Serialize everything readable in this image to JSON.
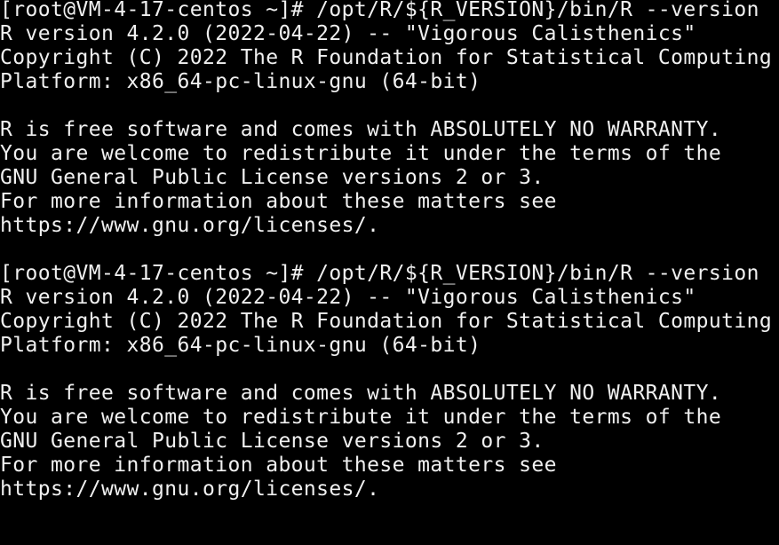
{
  "terminal": {
    "lines": [
      "[root@VM-4-17-centos ~]# /opt/R/${R_VERSION}/bin/R --version",
      "R version 4.2.0 (2022-04-22) -- \"Vigorous Calisthenics\"",
      "Copyright (C) 2022 The R Foundation for Statistical Computing",
      "Platform: x86_64-pc-linux-gnu (64-bit)",
      "",
      "R is free software and comes with ABSOLUTELY NO WARRANTY.",
      "You are welcome to redistribute it under the terms of the",
      "GNU General Public License versions 2 or 3.",
      "For more information about these matters see",
      "https://www.gnu.org/licenses/.",
      "",
      "[root@VM-4-17-centos ~]# /opt/R/${R_VERSION}/bin/R --version",
      "R version 4.2.0 (2022-04-22) -- \"Vigorous Calisthenics\"",
      "Copyright (C) 2022 The R Foundation for Statistical Computing",
      "Platform: x86_64-pc-linux-gnu (64-bit)",
      "",
      "R is free software and comes with ABSOLUTELY NO WARRANTY.",
      "You are welcome to redistribute it under the terms of the",
      "GNU General Public License versions 2 or 3.",
      "For more information about these matters see",
      "https://www.gnu.org/licenses/.",
      ""
    ]
  },
  "colors": {
    "background": "#000000",
    "foreground": "#f0f0f0"
  }
}
